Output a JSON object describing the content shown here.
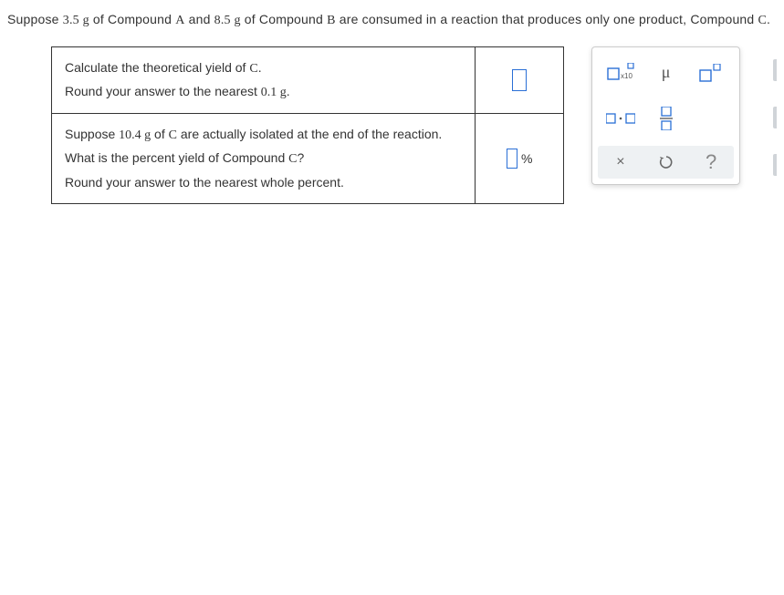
{
  "intro": {
    "part1": "Suppose ",
    "massA": "3.5 g",
    "part2": " of Compound ",
    "A": "A",
    "part3": " and ",
    "massB": "8.5 g",
    "part4": " of Compound ",
    "B": "B",
    "part5": " are consumed in a reaction that produces only one product, Compound ",
    "C": "C",
    "part6": "."
  },
  "q1": {
    "line1a": "Calculate the theoretical yield of ",
    "line1C": "C",
    "line1b": ".",
    "line2a": "Round your answer to the nearest ",
    "line2val": "0.1 g",
    "line2b": "."
  },
  "q2": {
    "line1a": "Suppose ",
    "line1val": "10.4 g",
    "line1b": " of ",
    "line1C": "C",
    "line1c": " are actually isolated at the end of the reaction.",
    "line2a": "What is the percent yield of Compound ",
    "line2C": "C",
    "line2b": "?",
    "line3": "Round your answer to the nearest whole percent.",
    "unit": "%"
  },
  "tools": {
    "sci": "x10",
    "mu": "μ",
    "times": "×",
    "reset": "↺",
    "help": "?"
  }
}
